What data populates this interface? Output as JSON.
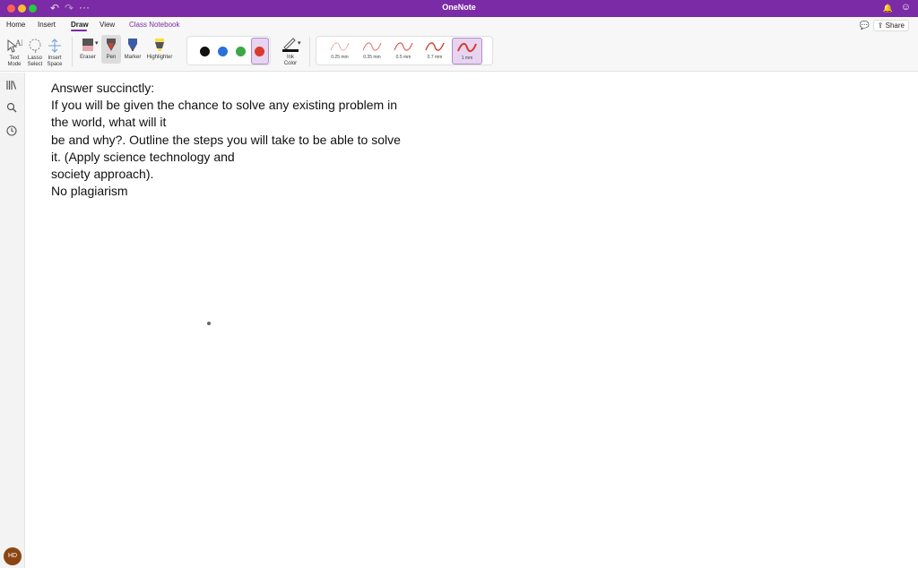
{
  "window": {
    "title": "OneNote",
    "toolbar_icons": [
      "undo-icon",
      "redo-icon",
      "more-icon"
    ]
  },
  "tabs": [
    {
      "label": "Home"
    },
    {
      "label": "Insert"
    },
    {
      "label": "Draw",
      "active": true
    },
    {
      "label": "View"
    },
    {
      "label": "Class Notebook"
    }
  ],
  "share_label": "Share",
  "ribbon": {
    "text_mode": [
      "Text",
      "Mode"
    ],
    "lasso_select": [
      "Lasso",
      "Select"
    ],
    "insert_space": [
      "Insert",
      "Space"
    ],
    "eraser": "Eraser",
    "pen": "Pen",
    "marker": "Marker",
    "highlighter": "Highlighter",
    "ink_color": [
      "Ink",
      "Color"
    ],
    "colors": [
      "#111111",
      "#2a6fdb",
      "#3aa845",
      "#d83b2d"
    ],
    "selected_color": "#d83b2d",
    "thicknesses": [
      "0.25 mm",
      "0.35 mm",
      "0.5 mm",
      "0.7 mm",
      "1 mm"
    ],
    "selected_thickness": "1 mm"
  },
  "rail_icons": [
    "notebooks-icon",
    "search-icon",
    "recent-icon"
  ],
  "user_initials": "HD",
  "note": {
    "lines": [
      "Answer succinctly:",
      "If you will be given the chance to solve any existing problem in",
      "the world, what will it",
      "be and why?. Outline the steps you will take to be able to solve",
      "it. (Apply science technology and",
      "society approach).",
      "No plagiarism"
    ]
  }
}
